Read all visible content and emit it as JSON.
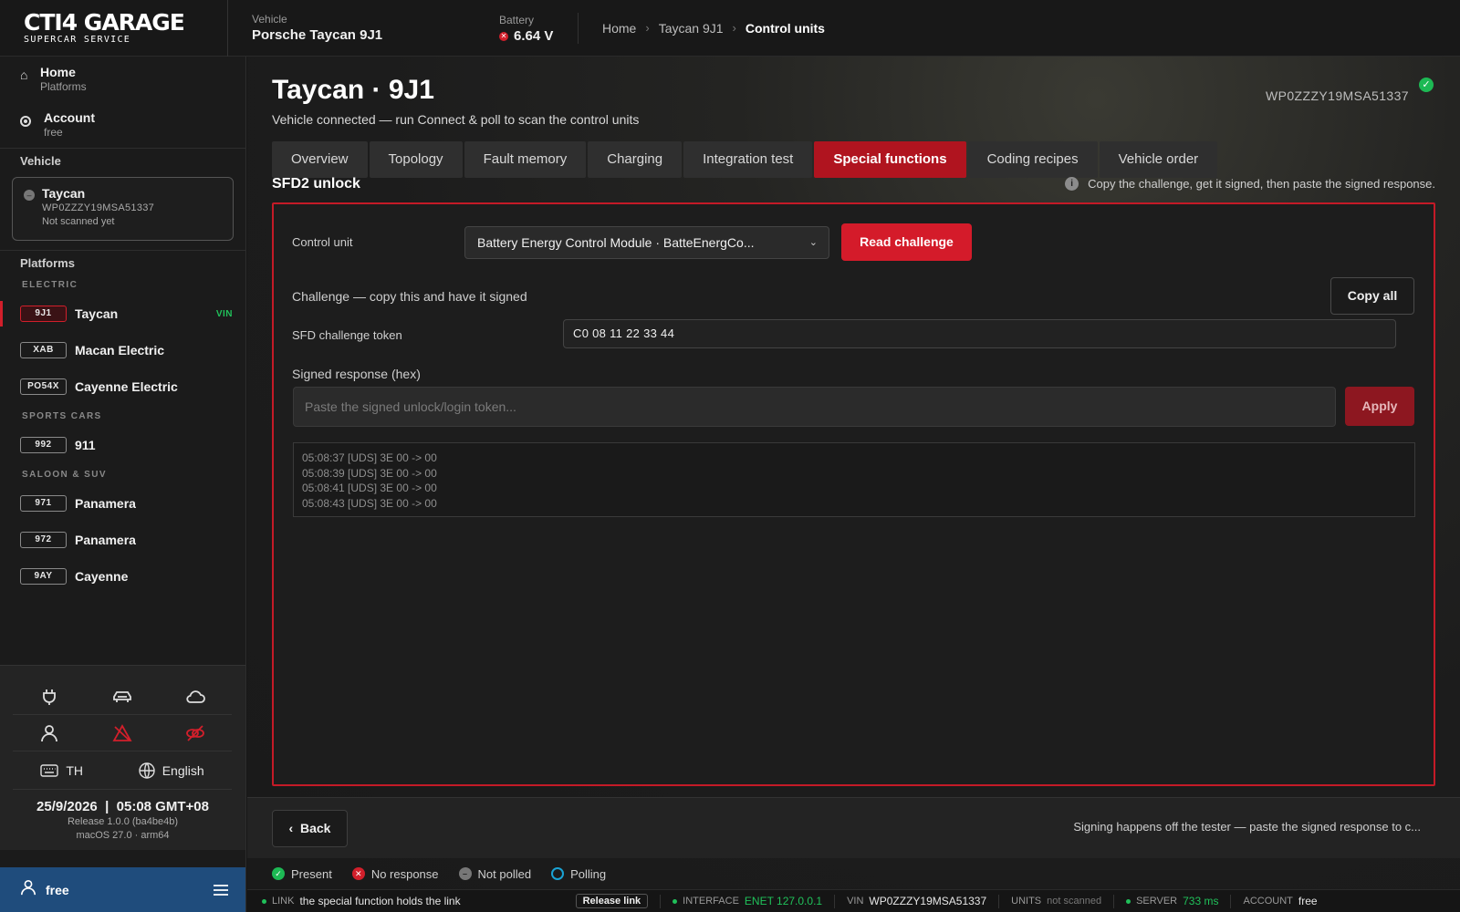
{
  "brand": {
    "name": "CTI4 GARAGE",
    "tagline": "SUPERCAR SERVICE"
  },
  "topbar": {
    "vehicle_label": "Vehicle",
    "vehicle_value": "Porsche Taycan 9J1",
    "battery_label": "Battery",
    "battery_value": "6.64 V",
    "breadcrumb": [
      "Home",
      "Taycan 9J1",
      "Control units"
    ]
  },
  "sidebar": {
    "nav": [
      {
        "title": "Home",
        "sub": "Platforms"
      },
      {
        "title": "Account",
        "sub": "free"
      }
    ],
    "vehicle_section": "Vehicle",
    "vehicle_card": {
      "name": "Taycan",
      "vin": "WP0ZZZY19MSA51337",
      "status": "Not scanned yet"
    },
    "platforms_section": "Platforms",
    "groups": [
      {
        "label": "ELECTRIC",
        "items": [
          {
            "code": "9J1",
            "name": "Taycan",
            "tag": "VIN"
          },
          {
            "code": "XAB",
            "name": "Macan Electric",
            "tag": ""
          },
          {
            "code": "PO54X",
            "name": "Cayenne Electric",
            "tag": ""
          }
        ]
      },
      {
        "label": "SPORTS CARS",
        "items": [
          {
            "code": "992",
            "name": "911",
            "tag": ""
          }
        ]
      },
      {
        "label": "SALOON & SUV",
        "items": [
          {
            "code": "971",
            "name": "Panamera",
            "tag": ""
          },
          {
            "code": "972",
            "name": "Panamera",
            "tag": ""
          },
          {
            "code": "9AY",
            "name": "Cayenne",
            "tag": ""
          }
        ]
      }
    ],
    "icons": [
      "plug-icon",
      "car-icon",
      "cloud-icon",
      "user-icon",
      "warning-off-icon",
      "link-off-icon"
    ],
    "keyboard_label": "TH",
    "language_label": "English",
    "date": "25/9/2026",
    "time": "05:08 GMT+08",
    "release": "Release 1.0.0 (ba4be4b)",
    "os": "macOS 27.0 · arm64",
    "user": "free"
  },
  "main": {
    "title": "Taycan · 9J1",
    "subtitle": "Vehicle connected — run Connect & poll to scan the control units",
    "vin": "WP0ZZZY19MSA51337",
    "tabs": [
      "Overview",
      "Topology",
      "Fault memory",
      "Charging",
      "Integration test",
      "Special functions",
      "Coding recipes",
      "Vehicle order"
    ],
    "active_tab": 5,
    "section_title": "SFD2 unlock",
    "section_hint": "Copy the challenge, get it signed, then paste the signed response.",
    "panel": {
      "control_unit_label": "Control unit",
      "control_unit_value": "Battery Energy Control Module  ·  BatteEnergCo...",
      "read_button": "Read challenge",
      "challenge_label": "Challenge — copy this and have it signed",
      "copy_button": "Copy all",
      "token_label": "SFD challenge token",
      "token_value": "C0 08 11 22 33 44",
      "response_label": "Signed response (hex)",
      "response_placeholder": "Paste the signed unlock/login token...",
      "apply_button": "Apply",
      "log": [
        "05:08:37  [UDS] 3E 00 -> 00",
        "05:08:39  [UDS] 3E 00 -> 00",
        "05:08:41  [UDS] 3E 00 -> 00",
        "05:08:43  [UDS] 3E 00 -> 00"
      ]
    },
    "back_button": "Back",
    "footer_note": "Signing happens off the tester — paste the signed response to c...",
    "legend": [
      "Present",
      "No response",
      "Not polled",
      "Polling"
    ]
  },
  "statusbar": {
    "link_label": "LINK",
    "link_value": "the special function holds the link",
    "release_button": "Release link",
    "interface_label": "INTERFACE",
    "interface_value": "ENET 127.0.0.1",
    "vin_label": "VIN",
    "vin_value": "WP0ZZZY19MSA51337",
    "units_label": "UNITS",
    "units_value": "not scanned",
    "server_label": "SERVER",
    "server_value": "733 ms",
    "account_label": "ACCOUNT",
    "account_value": "free"
  },
  "colors": {
    "accent": "#d41b2a",
    "ok": "#1db954",
    "user_bar": "#1f4c7c"
  }
}
